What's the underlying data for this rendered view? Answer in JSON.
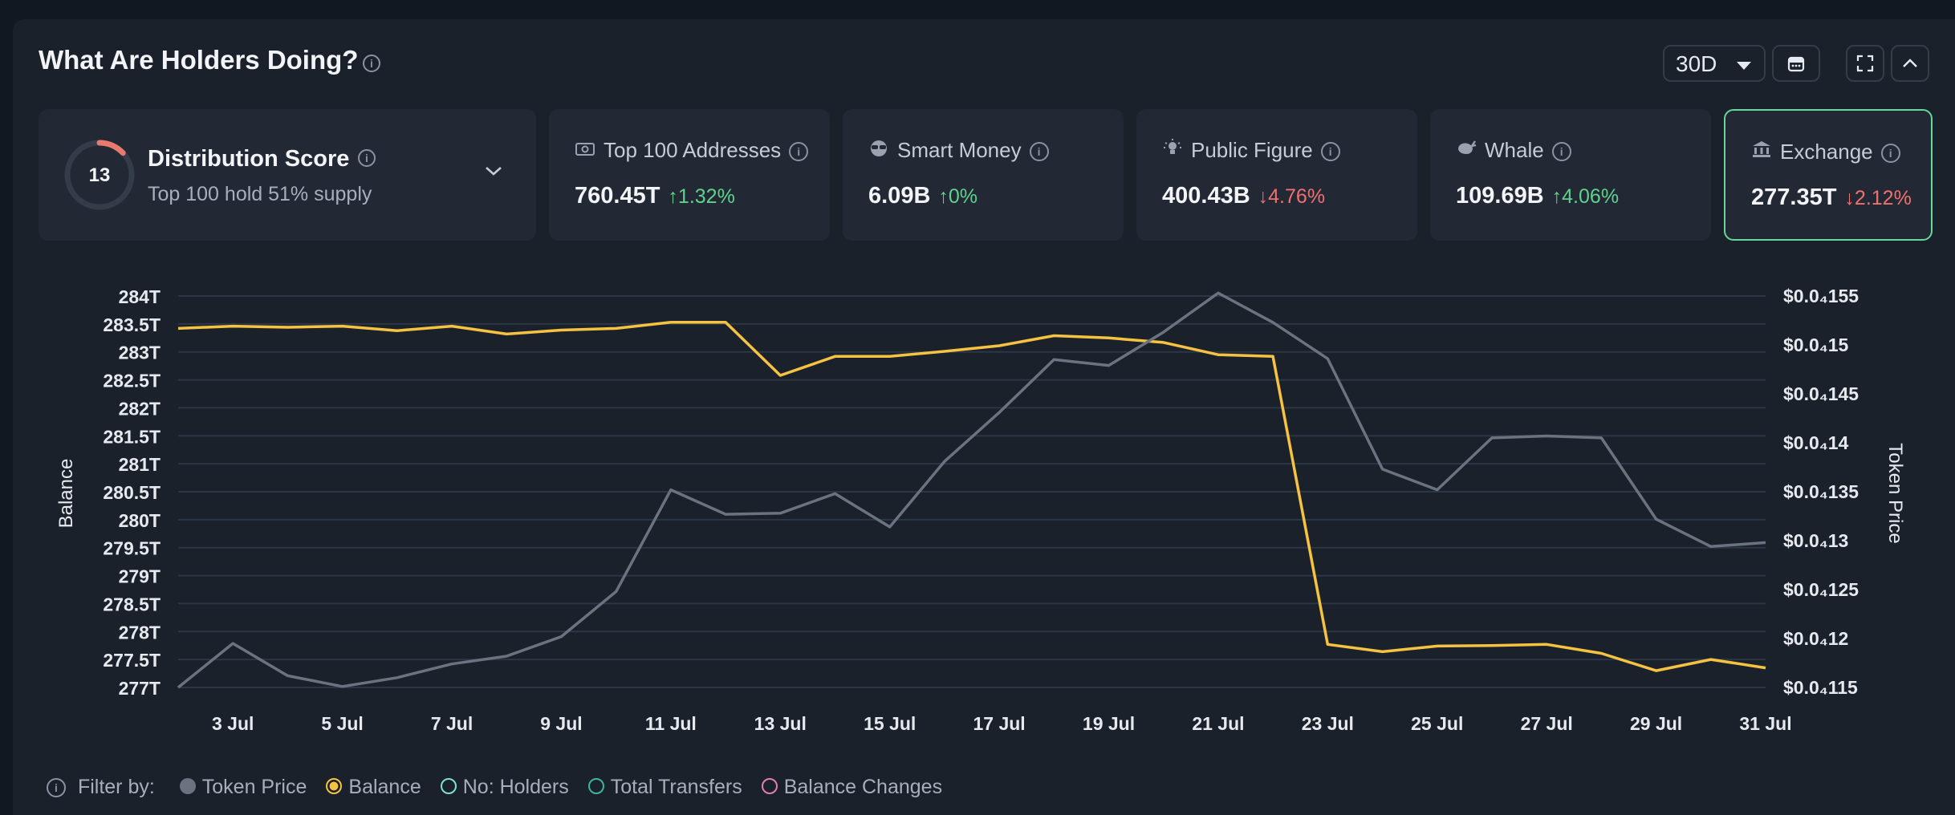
{
  "header": {
    "title": "What Are Holders Doing?"
  },
  "controls": {
    "range": "30D"
  },
  "distribution": {
    "score": "13",
    "score_fraction": 0.13,
    "title": "Distribution Score",
    "subtitle": "Top 100 hold 51% supply"
  },
  "cards": [
    {
      "label": "Top 100 Addresses",
      "value": "760.45T",
      "change": "1.32%",
      "direction": "up",
      "icon": "cash-icon"
    },
    {
      "label": "Smart Money",
      "value": "6.09B",
      "change": "0%",
      "direction": "up",
      "icon": "sunglasses-icon"
    },
    {
      "label": "Public Figure",
      "value": "400.43B",
      "change": "4.76%",
      "direction": "down",
      "icon": "bulb-icon"
    },
    {
      "label": "Whale",
      "value": "109.69B",
      "change": "4.06%",
      "direction": "up",
      "icon": "whale-icon"
    },
    {
      "label": "Exchange",
      "value": "277.35T",
      "change": "2.12%",
      "direction": "down",
      "icon": "bank-icon"
    }
  ],
  "legend": {
    "prefix": "Filter by:",
    "items": [
      {
        "name": "Token Price",
        "color": "#6b7280",
        "active": true
      },
      {
        "name": "Balance",
        "color": "#f5c242",
        "active": true
      },
      {
        "name": "No: Holders",
        "color": "#7ee0d0",
        "active": false
      },
      {
        "name": "Total Transfers",
        "color": "#3fb39b",
        "active": false
      },
      {
        "name": "Balance Changes",
        "color": "#e07fb8",
        "active": false
      }
    ]
  },
  "chart_data": {
    "type": "line",
    "x": [
      "2 Jul",
      "3 Jul",
      "4 Jul",
      "5 Jul",
      "6 Jul",
      "7 Jul",
      "8 Jul",
      "9 Jul",
      "10 Jul",
      "11 Jul",
      "12 Jul",
      "13 Jul",
      "14 Jul",
      "15 Jul",
      "16 Jul",
      "17 Jul",
      "18 Jul",
      "19 Jul",
      "20 Jul",
      "21 Jul",
      "22 Jul",
      "23 Jul",
      "24 Jul",
      "25 Jul",
      "26 Jul",
      "27 Jul",
      "28 Jul",
      "29 Jul",
      "30 Jul",
      "31 Jul"
    ],
    "x_tick_labels": [
      "3 Jul",
      "5 Jul",
      "7 Jul",
      "9 Jul",
      "11 Jul",
      "13 Jul",
      "15 Jul",
      "17 Jul",
      "19 Jul",
      "21 Jul",
      "23 Jul",
      "25 Jul",
      "27 Jul",
      "29 Jul",
      "31 Jul"
    ],
    "ylabel": "Balance",
    "y2label": "Token Price",
    "ylim": [
      277,
      284
    ],
    "y_ticks": [
      "284T",
      "283.5T",
      "283T",
      "282.5T",
      "282T",
      "281.5T",
      "281T",
      "280.5T",
      "280T",
      "279.5T",
      "279T",
      "278.5T",
      "278T",
      "277.5T",
      "277T"
    ],
    "y2lim": [
      0.01115,
      0.01155
    ],
    "y2_ticks": [
      "$0.0₄155",
      "$0.0₄15",
      "$0.0₄145",
      "$0.0₄14",
      "$0.0₄135",
      "$0.0₄13",
      "$0.0₄125",
      "$0.0₄12",
      "$0.0₄115"
    ],
    "series": [
      {
        "name": "Balance",
        "axis": "left",
        "color": "#f5c242",
        "values": [
          283.42,
          283.46,
          283.44,
          283.46,
          283.38,
          283.46,
          283.32,
          283.39,
          283.42,
          283.53,
          283.53,
          282.58,
          282.92,
          282.92,
          283.01,
          283.11,
          283.29,
          283.25,
          283.17,
          282.95,
          282.92,
          277.77,
          277.64,
          277.74,
          277.75,
          277.77,
          277.61,
          277.3,
          277.5,
          277.35
        ]
      },
      {
        "name": "Token Price",
        "axis": "right",
        "color": "#6b7280",
        "values": [
          0.01115,
          0.011195,
          0.011162,
          0.011151,
          0.01116,
          0.011174,
          0.011182,
          0.011202,
          0.011248,
          0.011352,
          0.011327,
          0.011328,
          0.011348,
          0.011314,
          0.011381,
          0.011431,
          0.011485,
          0.011479,
          0.011513,
          0.011553,
          0.011523,
          0.011486,
          0.011373,
          0.011352,
          0.011405,
          0.011407,
          0.011405,
          0.011322,
          0.011294,
          0.011298
        ]
      }
    ]
  }
}
